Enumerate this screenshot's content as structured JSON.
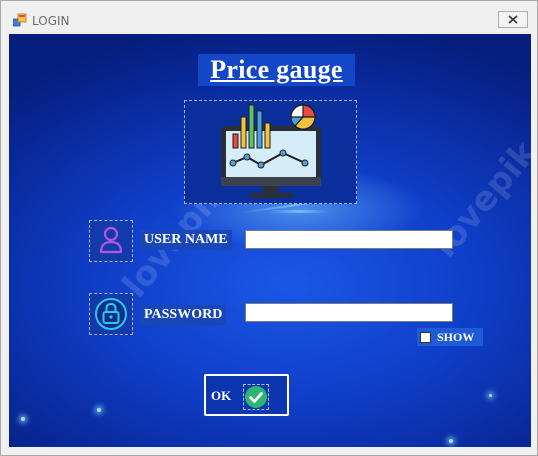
{
  "window": {
    "title": "LOGIN",
    "close_icon": "close-icon"
  },
  "form": {
    "heading": "Price gauge",
    "logo_icon": "dashboard-analytics-icon",
    "username": {
      "label": "USER NAME",
      "value": "",
      "icon": "user-icon"
    },
    "password": {
      "label": "PASSWORD",
      "value": "",
      "icon": "lock-icon"
    },
    "show_password": {
      "label": "SHOW",
      "checked": false
    },
    "ok_button": {
      "label": "OK",
      "icon": "check-circle-icon"
    }
  },
  "colors": {
    "background": "#0f3ec8",
    "accent_green": "#2bb673",
    "user_icon_purple": "#b455e6",
    "lock_icon_cyan": "#27c9f0"
  },
  "background_watermark": "lovepik.com"
}
